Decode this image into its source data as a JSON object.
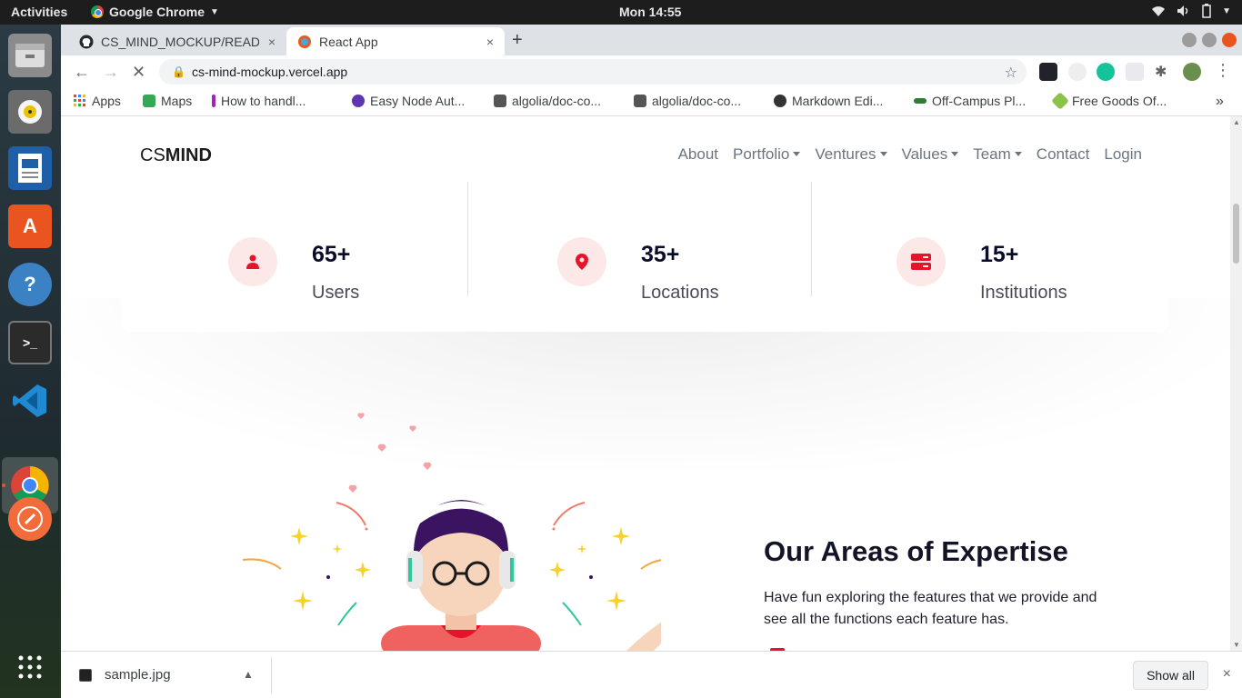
{
  "system": {
    "activities": "Activities",
    "app_name": "Google Chrome",
    "clock": "Mon 14:55"
  },
  "browser": {
    "tabs": [
      {
        "label": "CS_MIND_MOCKUP/READ",
        "close": "×"
      },
      {
        "label": "React App",
        "close": "×"
      }
    ],
    "new_tab": "+",
    "url": "cs-mind-mockup.vercel.app",
    "bookmarks": [
      {
        "label": "Apps",
        "color": "#ea4335"
      },
      {
        "label": "Maps",
        "color": "#34a853"
      },
      {
        "label": "How to handl...",
        "color": "#9c27b0"
      },
      {
        "label": "Easy Node Aut...",
        "color": "#5e35b1"
      },
      {
        "label": "algolia/doc-co...",
        "color": "#333333"
      },
      {
        "label": "algolia/doc-co...",
        "color": "#333333"
      },
      {
        "label": "Markdown Edi...",
        "color": "#333333"
      },
      {
        "label": "Off-Campus Pl...",
        "color": "#2e7d32"
      },
      {
        "label": "Free Goods Of...",
        "color": "#8bc34a"
      }
    ],
    "more_bookmarks": "»"
  },
  "site": {
    "brand_light": "CS",
    "brand_bold": "MIND",
    "nav": [
      {
        "label": "About",
        "dropdown": false
      },
      {
        "label": "Portfolio",
        "dropdown": true
      },
      {
        "label": "Ventures",
        "dropdown": true
      },
      {
        "label": "Values",
        "dropdown": true
      },
      {
        "label": "Team",
        "dropdown": true
      },
      {
        "label": "Contact",
        "dropdown": false
      },
      {
        "label": "Login",
        "dropdown": false
      }
    ],
    "stats": [
      {
        "value": "65+",
        "label": "Users",
        "icon": "user-icon"
      },
      {
        "value": "35+",
        "label": "Locations",
        "icon": "location-pin-icon"
      },
      {
        "value": "15+",
        "label": "Institutions",
        "icon": "server-icon"
      }
    ],
    "expertise": {
      "title": "Our Areas of Expertise",
      "description": "Have fun exploring the features that we provide and see all the functions each feature has."
    },
    "accent_color": "#e5142b"
  },
  "downloads": {
    "file": "sample.jpg",
    "show_all": "Show all",
    "close": "×"
  }
}
